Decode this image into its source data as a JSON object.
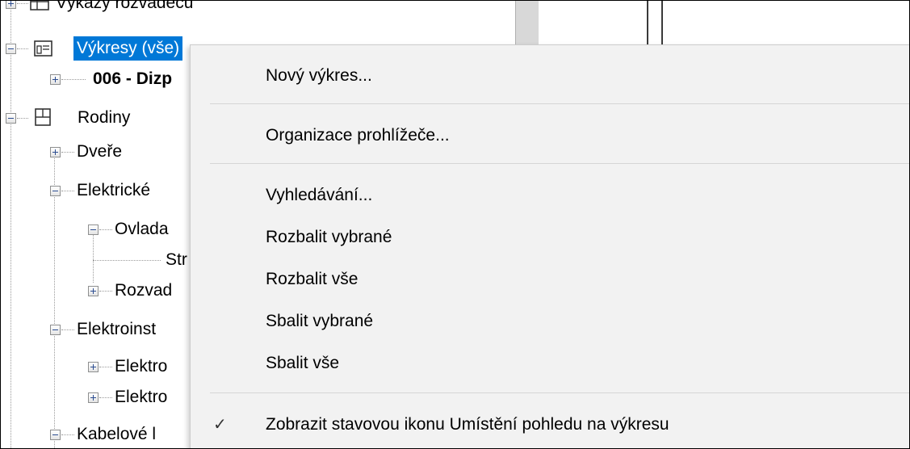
{
  "tree": {
    "items": [
      {
        "label": "Výkazy rozvaděčů"
      },
      {
        "label": "Výkresy (vše)"
      },
      {
        "label": "006 - Dizp"
      },
      {
        "label": "Rodiny"
      },
      {
        "label": "Dveře"
      },
      {
        "label": "Elektrické"
      },
      {
        "label": "Ovlada"
      },
      {
        "label": "Str"
      },
      {
        "label": "Rozvad"
      },
      {
        "label": "Elektroinst"
      },
      {
        "label": "Elektro"
      },
      {
        "label": "Elektro"
      },
      {
        "label": "Kabelové l"
      }
    ],
    "selection_color": "#0078d7"
  },
  "context_menu": {
    "items": [
      {
        "label": "Nový výkres..."
      },
      {
        "label": "Organizace prohlížeče..."
      },
      {
        "label": "Vyhledávání..."
      },
      {
        "label": "Rozbalit vybrané"
      },
      {
        "label": "Rozbalit vše"
      },
      {
        "label": "Sbalit vybrané"
      },
      {
        "label": "Sbalit vše"
      },
      {
        "label": "Zobrazit stavovou ikonu Umístění pohledu na výkresu",
        "checked": true,
        "check_glyph": "✓"
      }
    ]
  }
}
